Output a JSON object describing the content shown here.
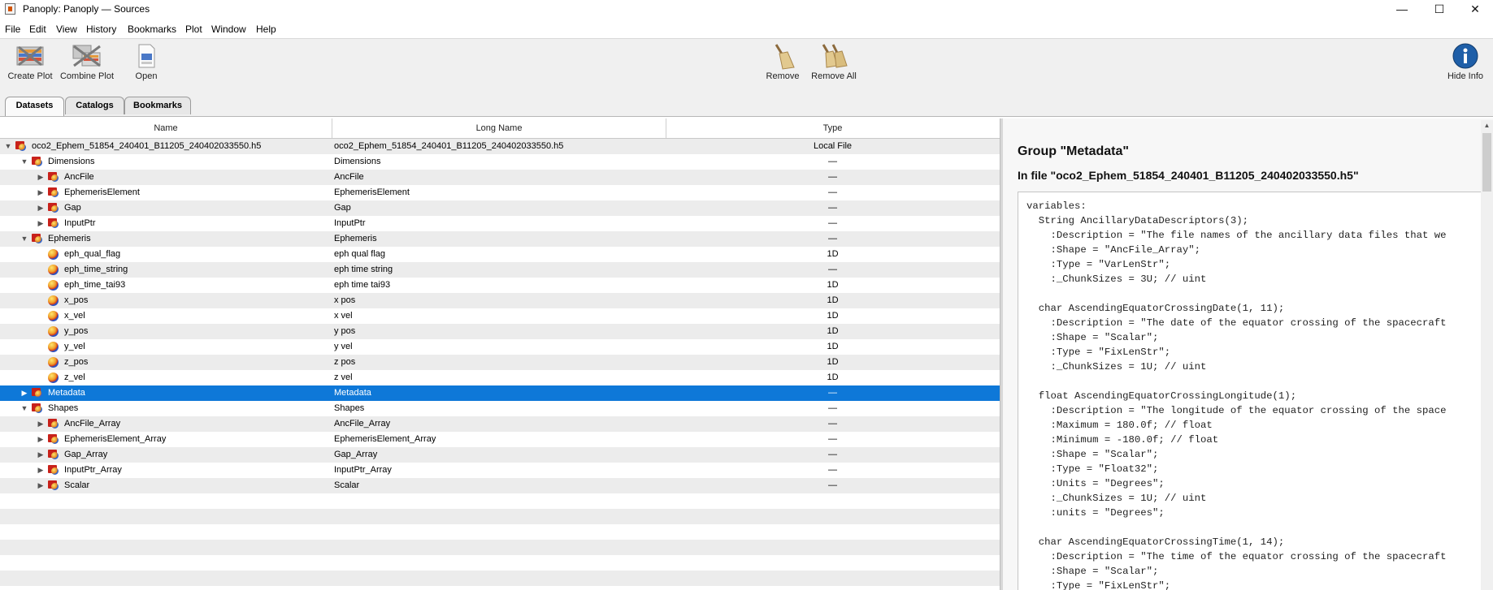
{
  "window": {
    "title": "Panoply: Panoply — Sources",
    "controls": {
      "minimize": "—",
      "maximize": "☐",
      "close": "✕"
    }
  },
  "menu": [
    "File",
    "Edit",
    "View",
    "History",
    "Bookmarks",
    "Plot",
    "Window",
    "Help"
  ],
  "toolbar": {
    "create_plot": "Create Plot",
    "combine_plot": "Combine Plot",
    "open": "Open",
    "remove": "Remove",
    "remove_all": "Remove All",
    "hide_info": "Hide Info"
  },
  "tabs": [
    "Datasets",
    "Catalogs",
    "Bookmarks"
  ],
  "table": {
    "columns": [
      "Name",
      "Long Name",
      "Type"
    ],
    "rows": [
      {
        "name": "oco2_Ephem_51854_240401_B11205_240402033550.h5",
        "long_name": "oco2_Ephem_51854_240401_B11205_240402033550.h5",
        "type": "Local File",
        "kind": "group",
        "expander": "▼"
      },
      {
        "name": "Dimensions",
        "long_name": "Dimensions",
        "type": "—",
        "kind": "group",
        "expander": "▼"
      },
      {
        "name": "AncFile",
        "long_name": "AncFile",
        "type": "—",
        "kind": "group",
        "expander": "▶"
      },
      {
        "name": "EphemerisElement",
        "long_name": "EphemerisElement",
        "type": "—",
        "kind": "group",
        "expander": "▶"
      },
      {
        "name": "Gap",
        "long_name": "Gap",
        "type": "—",
        "kind": "group",
        "expander": "▶"
      },
      {
        "name": "InputPtr",
        "long_name": "InputPtr",
        "type": "—",
        "kind": "group",
        "expander": "▶"
      },
      {
        "name": "Ephemeris",
        "long_name": "Ephemeris",
        "type": "—",
        "kind": "group",
        "expander": "▼"
      },
      {
        "name": "eph_qual_flag",
        "long_name": "eph qual flag",
        "type": "1D",
        "kind": "var",
        "expander": ""
      },
      {
        "name": "eph_time_string",
        "long_name": "eph time string",
        "type": "—",
        "kind": "var",
        "expander": ""
      },
      {
        "name": "eph_time_tai93",
        "long_name": "eph time tai93",
        "type": "1D",
        "kind": "var",
        "expander": ""
      },
      {
        "name": "x_pos",
        "long_name": "x pos",
        "type": "1D",
        "kind": "var",
        "expander": ""
      },
      {
        "name": "x_vel",
        "long_name": "x vel",
        "type": "1D",
        "kind": "var",
        "expander": ""
      },
      {
        "name": "y_pos",
        "long_name": "y pos",
        "type": "1D",
        "kind": "var",
        "expander": ""
      },
      {
        "name": "y_vel",
        "long_name": "y vel",
        "type": "1D",
        "kind": "var",
        "expander": ""
      },
      {
        "name": "z_pos",
        "long_name": "z pos",
        "type": "1D",
        "kind": "var",
        "expander": ""
      },
      {
        "name": "z_vel",
        "long_name": "z vel",
        "type": "1D",
        "kind": "var",
        "expander": ""
      },
      {
        "name": "Metadata",
        "long_name": "Metadata",
        "type": "—",
        "kind": "group",
        "expander": "▶",
        "selected": true
      },
      {
        "name": "Shapes",
        "long_name": "Shapes",
        "type": "—",
        "kind": "group",
        "expander": "▼"
      },
      {
        "name": "AncFile_Array",
        "long_name": "AncFile_Array",
        "type": "—",
        "kind": "group",
        "expander": "▶"
      },
      {
        "name": "EphemerisElement_Array",
        "long_name": "EphemerisElement_Array",
        "type": "—",
        "kind": "group",
        "expander": "▶"
      },
      {
        "name": "Gap_Array",
        "long_name": "Gap_Array",
        "type": "—",
        "kind": "group",
        "expander": "▶"
      },
      {
        "name": "InputPtr_Array",
        "long_name": "InputPtr_Array",
        "type": "—",
        "kind": "group",
        "expander": "▶"
      },
      {
        "name": "Scalar",
        "long_name": "Scalar",
        "type": "—",
        "kind": "group",
        "expander": "▶"
      }
    ]
  },
  "info": {
    "heading": "Group \"Metadata\"",
    "subheading": "In file \"oco2_Ephem_51854_240401_B11205_240402033550.h5\"",
    "lines": [
      "variables:",
      "  String AncillaryDataDescriptors(3);",
      "    :Description = \"The file names of the ancillary data files that we",
      "    :Shape = \"AncFile_Array\";",
      "    :Type = \"VarLenStr\";",
      "    :_ChunkSizes = 3U; // uint",
      "",
      "  char AscendingEquatorCrossingDate(1, 11);",
      "    :Description = \"The date of the equator crossing of the spacecraft",
      "    :Shape = \"Scalar\";",
      "    :Type = \"FixLenStr\";",
      "    :_ChunkSizes = 1U; // uint",
      "",
      "  float AscendingEquatorCrossingLongitude(1);",
      "    :Description = \"The longitude of the equator crossing of the space",
      "    :Maximum = 180.0f; // float",
      "    :Minimum = -180.0f; // float",
      "    :Shape = \"Scalar\";",
      "    :Type = \"Float32\";",
      "    :Units = \"Degrees\";",
      "    :_ChunkSizes = 1U; // uint",
      "    :units = \"Degrees\";",
      "",
      "  char AscendingEquatorCrossingTime(1, 14);",
      "    :Description = \"The time of the equator crossing of the spacecraft",
      "    :Shape = \"Scalar\";",
      "    :Type = \"FixLenStr\";"
    ]
  }
}
